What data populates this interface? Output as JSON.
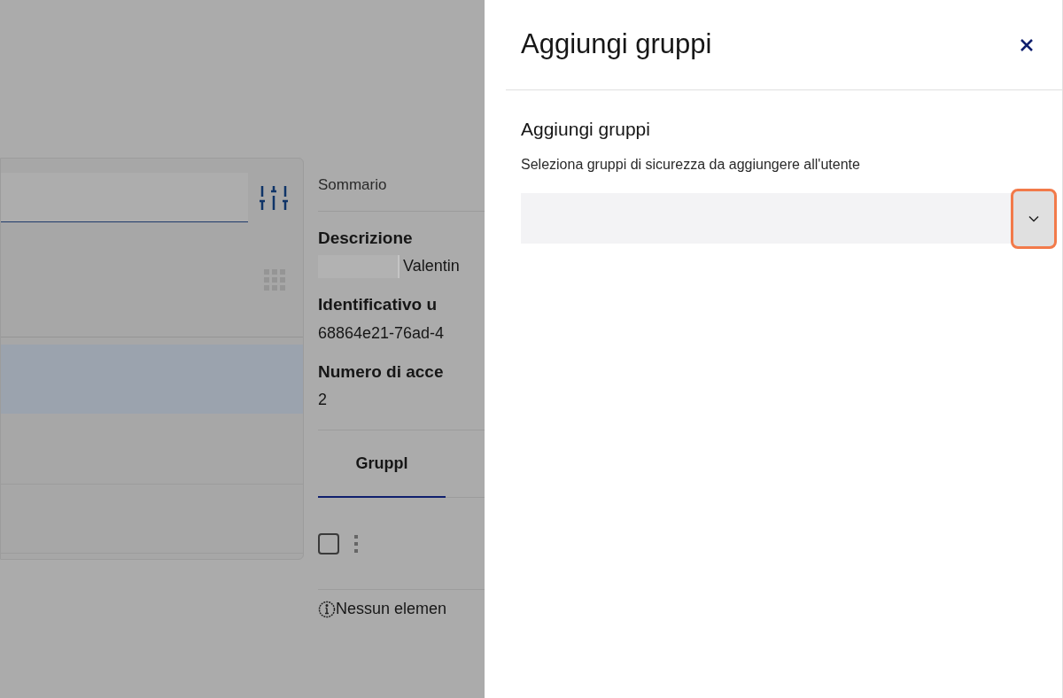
{
  "background": {
    "summary_label": "Sommario",
    "fields": [
      {
        "label": "Descrizione",
        "value": "Valentin",
        "redacted": true
      },
      {
        "label": "Identificativo u",
        "value": "68864e21-76ad-4",
        "redacted": false
      },
      {
        "label": "Numero di acce",
        "value": "2",
        "redacted": false
      }
    ],
    "tabs": [
      {
        "label": "Gruppl",
        "selected": true
      }
    ],
    "select_all": {
      "checked": false
    },
    "empty_message": "Nessun elemen"
  },
  "drawer": {
    "title": "Aggiungi gruppi",
    "section_title": "Aggiungi gruppi",
    "description": "Seleziona gruppi di sicurezza da aggiungere all'utente",
    "dropdown": {
      "highlighted": true
    }
  }
}
